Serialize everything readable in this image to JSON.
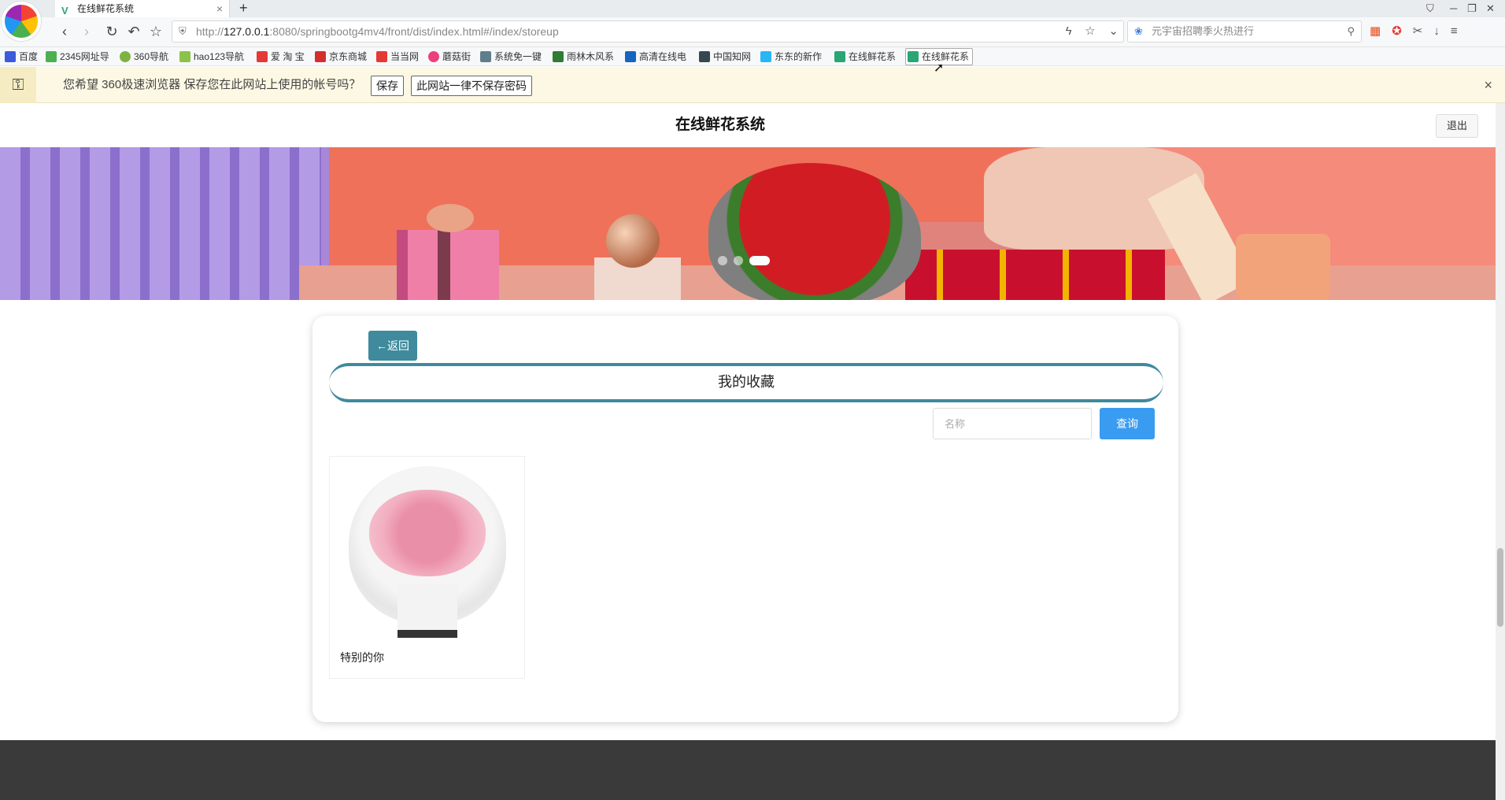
{
  "browser": {
    "tab_title": "在线鲜花系统",
    "tab_favicon": "V",
    "url_prefix": "http://",
    "url_host": "127.0.0.1",
    "url_rest": ":8080/springbootg4mv4/front/dist/index.html#/index/storeup",
    "search_placeholder": "元宇宙招聘季火热进行",
    "bookmarks": [
      "百度",
      "2345网址导",
      "360导航",
      "hao123导航",
      "爱 淘 宝",
      "京东商城",
      "当当网",
      "蘑菇街",
      "系统免一键",
      "雨林木风系",
      "高清在线电",
      "中国知网",
      "东东的新作",
      "在线鲜花系",
      "在线鲜花系"
    ],
    "password_prompt": {
      "message": "您希望 360极速浏览器 保存您在此网站上使用的帐号吗？",
      "save_label": "保存",
      "never_label": "此网站一律不保存密码"
    }
  },
  "site": {
    "title": "在线鲜花系统",
    "logout_label": "退出"
  },
  "storeup": {
    "back_label": "←返回",
    "section_title": "我的收藏",
    "search_placeholder": "名称",
    "query_label": "查询",
    "items": [
      {
        "name": "特别的你"
      }
    ]
  },
  "colors": {
    "accent": "#3f8a9d",
    "query": "#3a9cf0",
    "footer": "#3a3a3a"
  }
}
